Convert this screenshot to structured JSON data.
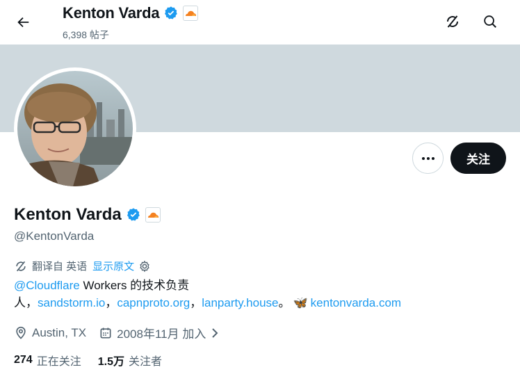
{
  "header": {
    "name": "Kenton Varda",
    "posts_count": "6,398 帖子"
  },
  "profile": {
    "name": "Kenton Varda",
    "handle": "@KentonVarda",
    "follow_label": "关注",
    "verified_color": "#1d9bf0",
    "affiliation_badge": "cloudflare-logo"
  },
  "translate": {
    "label": "翻译自 英语",
    "show_original": "显示原文"
  },
  "bio": {
    "mention": "@Cloudflare",
    "text1": " Workers 的技术负责",
    "text2": "人，",
    "link1": "sandstorm.io",
    "sep1": "，",
    "link2": "capnproto.org",
    "sep2": "，",
    "link3": "lanparty.house",
    "sep3": "。",
    "butterfly": "🦋",
    "link4": "kentonvarda.com"
  },
  "meta": {
    "location": "Austin, TX",
    "joined": "2008年11月 加入"
  },
  "stats": {
    "following_count": "274",
    "following_label": "正在关注",
    "followers_count": "1.5万",
    "followers_label": "关注者"
  },
  "icons": [
    "back-arrow-icon",
    "verified-badge-icon",
    "cloudflare-logo-icon",
    "grok-icon",
    "search-icon",
    "more-icon",
    "translate-icon",
    "gear-icon",
    "location-icon",
    "calendar-icon",
    "chevron-right-icon"
  ]
}
